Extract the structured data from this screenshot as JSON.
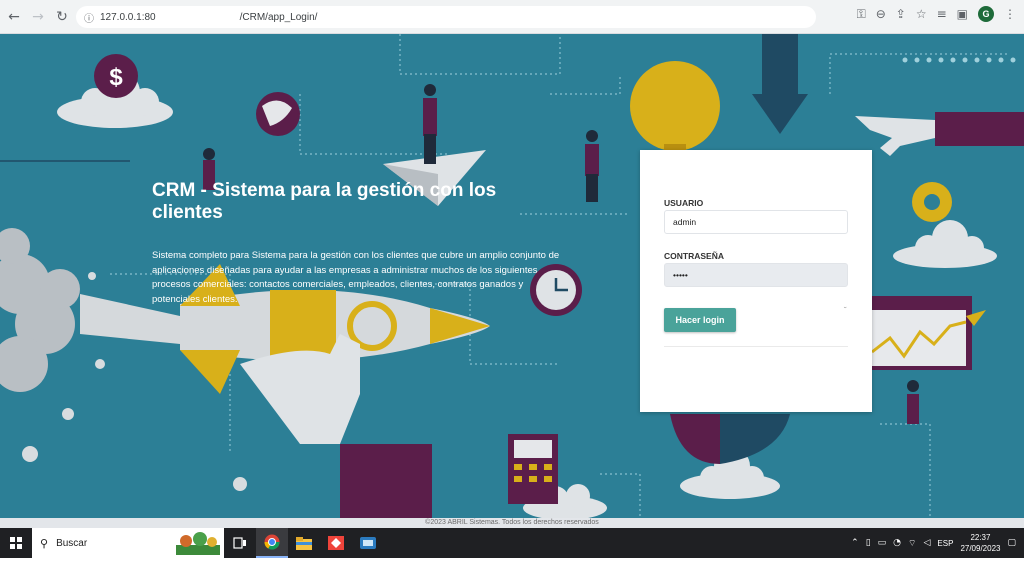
{
  "browser": {
    "url_prefix": "127.0.0.1:80",
    "url_suffix": "/CRM/app_Login/",
    "profile_initial": "G"
  },
  "hero": {
    "title": "CRM - Sistema para la gestión con los clientes",
    "description": "Sistema completo para Sistema para la gestión con los clientes que cubre un amplio conjunto de aplicaciones diseñadas para ayudar a las empresas a administrar muchos de los siguientes procesos comerciales: contactos comerciales, empleados, clientes, contratos ganados y potenciales clientes."
  },
  "login": {
    "user_label": "USUARIO",
    "user_value": "admin",
    "pass_label": "CONTRASEÑA",
    "pass_value": "•••••",
    "button_label": "Hacer login"
  },
  "footer": {
    "text": "©2023 ABRIL Sistemas. Todos los derechos reservados"
  },
  "taskbar": {
    "search_placeholder": "Buscar",
    "language": "ESP",
    "time": "22:37",
    "date": "27/09/2023"
  },
  "colors": {
    "page_bg": "#2c7f96",
    "login_button": "#4aa39a",
    "accent_purple": "#5b1e4a",
    "accent_yellow": "#d8b01a"
  }
}
